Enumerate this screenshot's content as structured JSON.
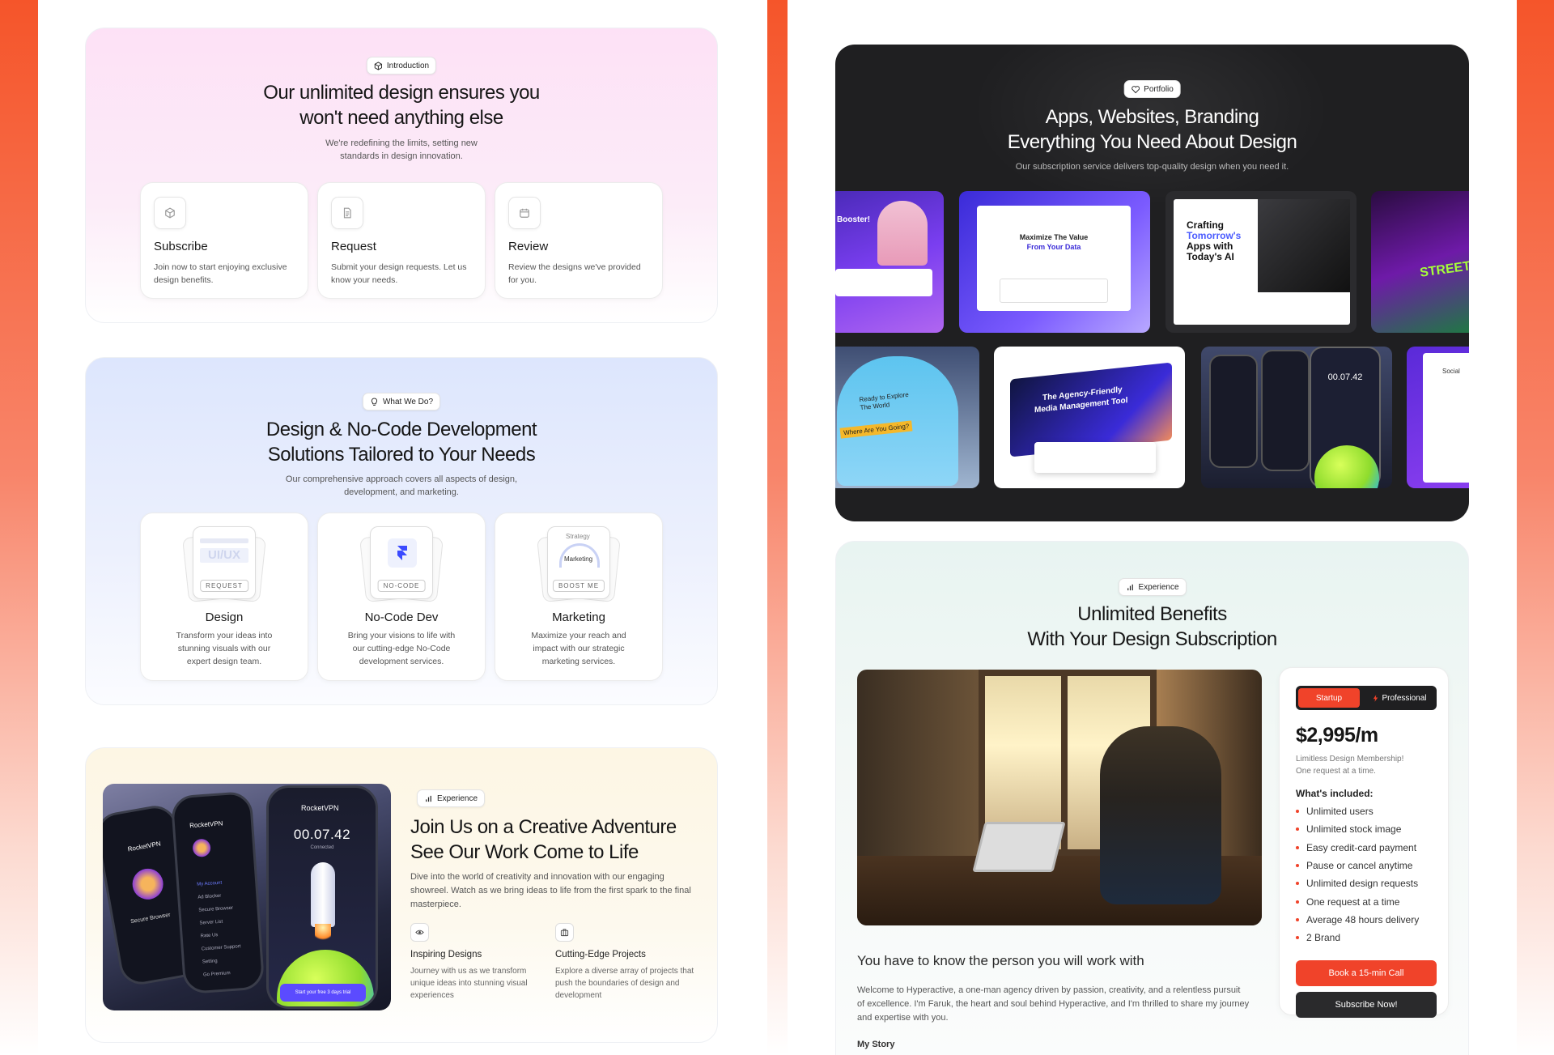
{
  "intro": {
    "badge": "Introduction",
    "title_line1": "Our unlimited design ensures you",
    "title_line2": "won't need anything else",
    "subtitle_line1": "We're redefining the limits, setting new",
    "subtitle_line2": "standards in design innovation.",
    "steps": [
      {
        "title": "Subscribe",
        "desc": "Join now to start enjoying exclusive design benefits.",
        "icon": "cube-icon"
      },
      {
        "title": "Request",
        "desc": "Submit your design requests. Let us know your needs.",
        "icon": "document-icon"
      },
      {
        "title": "Review",
        "desc": "Review the designs we've provided for you.",
        "icon": "calendar-icon"
      }
    ]
  },
  "services": {
    "badge": "What We Do?",
    "title_line1": "Design & No-Code Development",
    "title_line2": "Solutions Tailored to Your Needs",
    "subtitle_line1": "Our comprehensive approach covers all aspects of design,",
    "subtitle_line2": "development, and marketing.",
    "items": [
      {
        "title": "Design",
        "desc": "Transform your ideas into stunning visuals with our expert design team.",
        "tag": "REQUEST",
        "art": "UI/UX"
      },
      {
        "title": "No-Code Dev",
        "desc": "Bring your visions to life with our cutting-edge No-Code development services.",
        "tag": "NO-CODE"
      },
      {
        "title": "Marketing",
        "desc": "Maximize your reach and impact with our strategic marketing services.",
        "tag": "BOOST ME",
        "art_top": "Strategy",
        "art_mid": "Marketing"
      }
    ]
  },
  "experience_left": {
    "badge": "Experience",
    "title_line1": "Join Us on a Creative Adventure",
    "title_line2": "See Our Work Come to Life",
    "desc": "Dive into the world of creativity and innovation with our engaging showreel. Watch as we bring ideas to life from the first spark to the final masterpiece.",
    "features": [
      {
        "title": "Inspiring Designs",
        "desc": "Journey with us as we transform unique ideas into stunning visual experiences",
        "icon": "eye-icon"
      },
      {
        "title": "Cutting-Edge Projects",
        "desc": "Explore a diverse array of projects that push the boundaries of design and development",
        "icon": "briefcase-icon"
      }
    ],
    "phone": {
      "app_name": "RocketVPN",
      "timer": "00.07.42",
      "status": "Connected",
      "secure": "Secure Browser",
      "cta": "Start your free 3 days trial",
      "menu": [
        "My Account",
        "Ad Blocker",
        "Secure Browser",
        "Server List",
        "Rate Us",
        "Customer Support",
        "Setting",
        "Go Premium"
      ]
    }
  },
  "portfolio": {
    "badge": "Portfolio",
    "title_line1": "Apps, Websites, Branding",
    "title_line2": "Everything You Need About Design",
    "subtitle": "Our subscription service delivers top-quality design when you need it.",
    "shots": [
      {
        "label": "Booster!"
      },
      {
        "label_line1": "Maximize The Value",
        "label_line2": "From Your Data"
      },
      {
        "label_line1": "Crafting",
        "label_line2": "Tomorrow's",
        "label_line3": "Apps with",
        "label_line4": "Today's AI"
      },
      {
        "label": "STREET ART"
      },
      {
        "label_line1": "Ready to Explore",
        "label_line2": "The World",
        "label_line3": "Where Are You Going?"
      },
      {
        "label_line1": "The Agency-Friendly",
        "label_line2": "Media Management Tool"
      },
      {
        "label": "00.07.42"
      },
      {
        "label": "Social"
      }
    ]
  },
  "benefits": {
    "badge": "Experience",
    "title_line1": "Unlimited Benefits",
    "title_line2": "With Your Design Subscription",
    "person_heading": "You have to know the person you will work with",
    "person_desc": "Welcome to Hyperactive, a one-man agency driven by passion, creativity, and a relentless pursuit of excellence. I'm Faruk, the heart and soul behind Hyperactive, and I'm thrilled to share my journey and expertise with you.",
    "story_label": "My Story",
    "pricing": {
      "tabs": [
        "Startup",
        "Professional"
      ],
      "active_tab": "Startup",
      "price": "$2,995/m",
      "desc_line1": "Limitless Design Membership!",
      "desc_line2": "One request at a time.",
      "included_label": "What's included:",
      "features": [
        "Unlimited users",
        "Unlimited stock image",
        "Easy credit-card payment",
        "Pause or cancel anytime",
        "Unlimited design requests",
        "One request at a time",
        "Average 48 hours delivery",
        "2 Brand"
      ],
      "book_button": "Book a 15-min Call",
      "subscribe_button": "Subscribe Now!"
    }
  },
  "colors": {
    "accent": "#f0432a",
    "dark": "#1f1f21"
  }
}
